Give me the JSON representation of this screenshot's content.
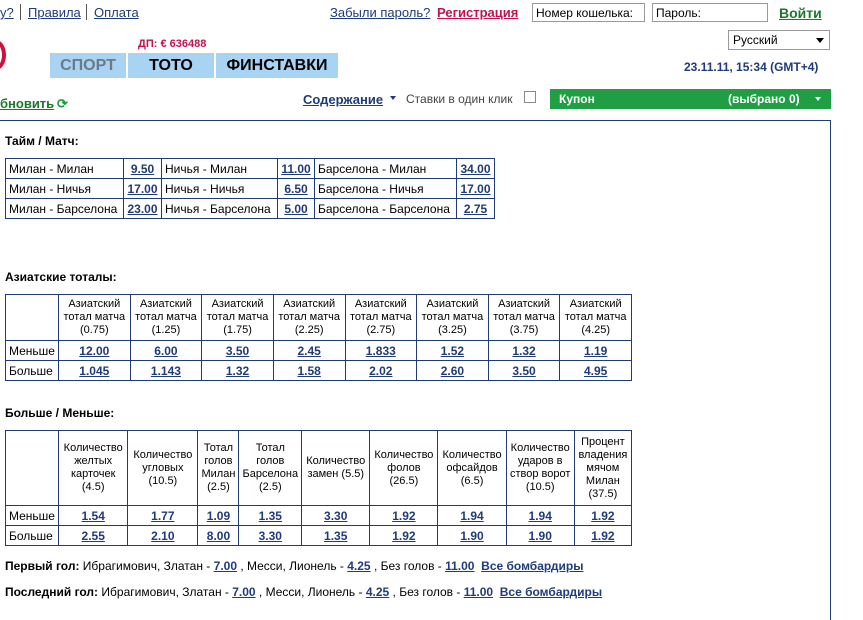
{
  "top": {
    "partial_link": "у?",
    "rules": "Правила",
    "payment": "Оплата",
    "forgot": "Забыли пароль?",
    "register": "Регистрация",
    "wallet_placeholder": "Номер кошелька:",
    "password_placeholder": "Пароль:",
    "login": "Войти"
  },
  "header": {
    "dp": "ДП: € 636488",
    "tabs": [
      "СПОРТ",
      "ТОТО",
      "ФИНСТАВКИ"
    ],
    "language": "Русский",
    "datetime": "23.11.11, 15:34 (GMT+4)"
  },
  "toolbar": {
    "refresh": "бновить",
    "refresh_icon": "⟳",
    "contents": "Содержание",
    "one_click": "Ставки в один клик",
    "coupon_label": "Купон",
    "coupon_count": "(выбрано 0)"
  },
  "half_match": {
    "title": "Тайм / Матч:",
    "rows": [
      [
        [
          "Милан - Милан",
          "9.50"
        ],
        [
          "Ничья - Милан",
          "11.00"
        ],
        [
          "Барселона - Милан",
          "34.00"
        ]
      ],
      [
        [
          "Милан - Ничья",
          "17.00"
        ],
        [
          "Ничья - Ничья",
          "6.50"
        ],
        [
          "Барселона - Ничья",
          "17.00"
        ]
      ],
      [
        [
          "Милан - Барселона",
          "23.00"
        ],
        [
          "Ничья - Барселона",
          "5.00"
        ],
        [
          "Барселона - Барселона",
          "2.75"
        ]
      ]
    ]
  },
  "asian": {
    "title": "Азиатские тоталы:",
    "headers": [
      "Азиатский тотал матча (0.75)",
      "Азиатский тотал матча (1.25)",
      "Азиатский тотал матча (1.75)",
      "Азиатский тотал матча (2.25)",
      "Азиатский тотал матча (2.75)",
      "Азиатский тотал матча (3.25)",
      "Азиатский тотал матча (3.75)",
      "Азиатский тотал матча (4.25)"
    ],
    "rows": [
      {
        "label": "Меньше",
        "values": [
          "12.00",
          "6.00",
          "3.50",
          "2.45",
          "1.833",
          "1.52",
          "1.32",
          "1.19"
        ]
      },
      {
        "label": "Больше",
        "values": [
          "1.045",
          "1.143",
          "1.32",
          "1.58",
          "2.02",
          "2.60",
          "3.50",
          "4.95"
        ]
      }
    ]
  },
  "overunder": {
    "title": "Больше / Меньше:",
    "headers": [
      "Количество желтых карточек (4.5)",
      "Количество угловых (10.5)",
      "Тотал голов Милан (2.5)",
      "Тотал голов Барселона (2.5)",
      "Количество замен (5.5)",
      "Количество фолов (26.5)",
      "Количество офсайдов (6.5)",
      "Количество ударов в створ ворот (10.5)",
      "Процент владения мячом Милан (37.5)"
    ],
    "rows": [
      {
        "label": "Меньше",
        "values": [
          "1.54",
          "1.77",
          "1.09",
          "1.35",
          "3.30",
          "1.92",
          "1.94",
          "1.94",
          "1.92"
        ]
      },
      {
        "label": "Больше",
        "values": [
          "2.55",
          "2.10",
          "8.00",
          "3.30",
          "1.35",
          "1.92",
          "1.90",
          "1.90",
          "1.92"
        ]
      }
    ]
  },
  "goals": [
    {
      "label": "Первый гол:",
      "p1": " Ибрагимович, Златан - ",
      "v1": "7.00",
      "p2": " , Месси, Лионель - ",
      "v2": "4.25",
      "p3": " , Без голов - ",
      "v3": "11.00",
      "all": "Все бомбардиры"
    },
    {
      "label": "Последний гол:",
      "p1": " Ибрагимович, Златан - ",
      "v1": "7.00",
      "p2": " , Месси, Лионель - ",
      "v2": "4.25",
      "p3": " , Без голов - ",
      "v3": "11.00",
      "all": "Все бомбардиры"
    }
  ]
}
